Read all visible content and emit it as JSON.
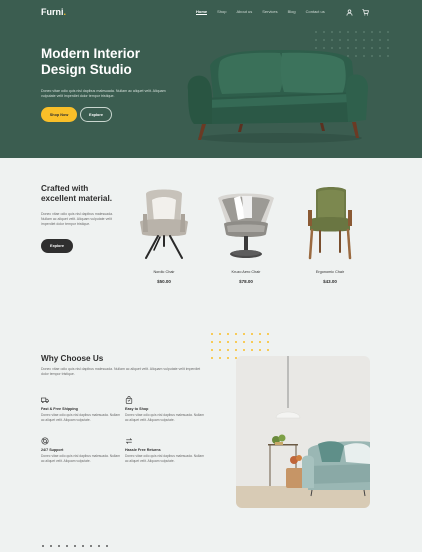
{
  "brand": {
    "name": "Furni",
    "dot": ".",
    "accent": "#f9bf29",
    "hero_bg": "#3b5d50"
  },
  "nav": {
    "items": [
      "Home",
      "Shop",
      "About us",
      "Services",
      "Blog",
      "Contact us"
    ],
    "icons": [
      "user-icon",
      "cart-icon"
    ]
  },
  "hero": {
    "title_line1": "Modern Interior",
    "title_line2": "Design Studio",
    "description": "Donec vitae odio quis nisl dapibus malesuada. Nullam ac aliquet velit. Aliquam vulputate velit imperdiet dolor tempor tristique.",
    "shop_now": "Shop Now",
    "explore": "Explore"
  },
  "products_section": {
    "title_line1": "Crafted with",
    "title_line2": "excellent material.",
    "description": "Donec vitae odio quis nisl dapibus malesuada. Nullam ac aliquet velit. Aliquam vulputate velit imperdiet dolor tempor tristique.",
    "explore": "Explore",
    "items": [
      {
        "name": "Nordic Chair",
        "price": "$50.00"
      },
      {
        "name": "Kruzo Aero Chair",
        "price": "$78.00"
      },
      {
        "name": "Ergonomic Chair",
        "price": "$43.00"
      }
    ]
  },
  "why": {
    "title": "Why Choose Us",
    "description": "Donec vitae odio quis nisl dapibus malesuada. Nullam ac aliquet velit. Aliquam vulputate velit imperdiet dolor tempor tristique.",
    "features": [
      {
        "icon": "truck-icon",
        "title": "Fast & Free Shipping",
        "desc": "Donec vitae odio quis nisl dapibus malesuada. Nullam ac aliquet velit. Aliquam vulputate."
      },
      {
        "icon": "bag-icon",
        "title": "Easy to Shop",
        "desc": "Donec vitae odio quis nisl dapibus malesuada. Nullam ac aliquet velit. Aliquam vulputate."
      },
      {
        "icon": "support-icon",
        "title": "24/7 Support",
        "desc": "Donec vitae odio quis nisl dapibus malesuada. Nullam ac aliquet velit. Aliquam vulputate."
      },
      {
        "icon": "return-icon",
        "title": "Hassle Free Returns",
        "desc": "Donec vitae odio quis nisl dapibus malesuada. Nullam ac aliquet velit. Aliquam vulputate."
      }
    ]
  }
}
